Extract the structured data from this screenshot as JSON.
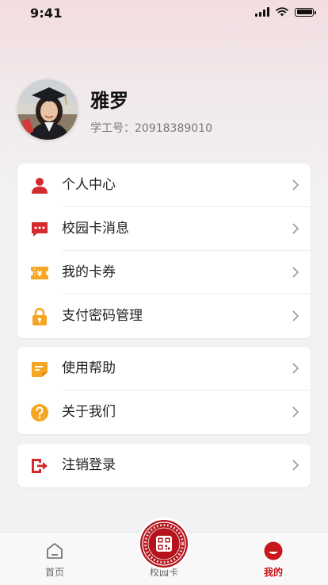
{
  "status_bar": {
    "time": "9:41"
  },
  "profile": {
    "name": "雅罗",
    "id_label": "学工号：",
    "id_value": "20918389010"
  },
  "menu_groups": [
    [
      {
        "label": "个人中心",
        "icon": "person-icon",
        "color": "#d42b2f"
      },
      {
        "label": "校园卡消息",
        "icon": "message-icon",
        "color": "#d42b2f"
      },
      {
        "label": "我的卡券",
        "icon": "coupon-icon",
        "color": "#f5a623"
      },
      {
        "label": "支付密码管理",
        "icon": "lock-icon",
        "color": "#f5a623"
      }
    ],
    [
      {
        "label": "使用帮助",
        "icon": "help-doc-icon",
        "color": "#f5a623"
      },
      {
        "label": "关于我们",
        "icon": "question-icon",
        "color": "#f5a623"
      }
    ],
    [
      {
        "label": "注销登录",
        "icon": "logout-icon",
        "color": "#d42b2f"
      }
    ]
  ],
  "tabbar": {
    "home": "首页",
    "card": "校园卡",
    "mine": "我的"
  },
  "colors": {
    "accent": "#c8161d",
    "orange": "#f5a623"
  }
}
